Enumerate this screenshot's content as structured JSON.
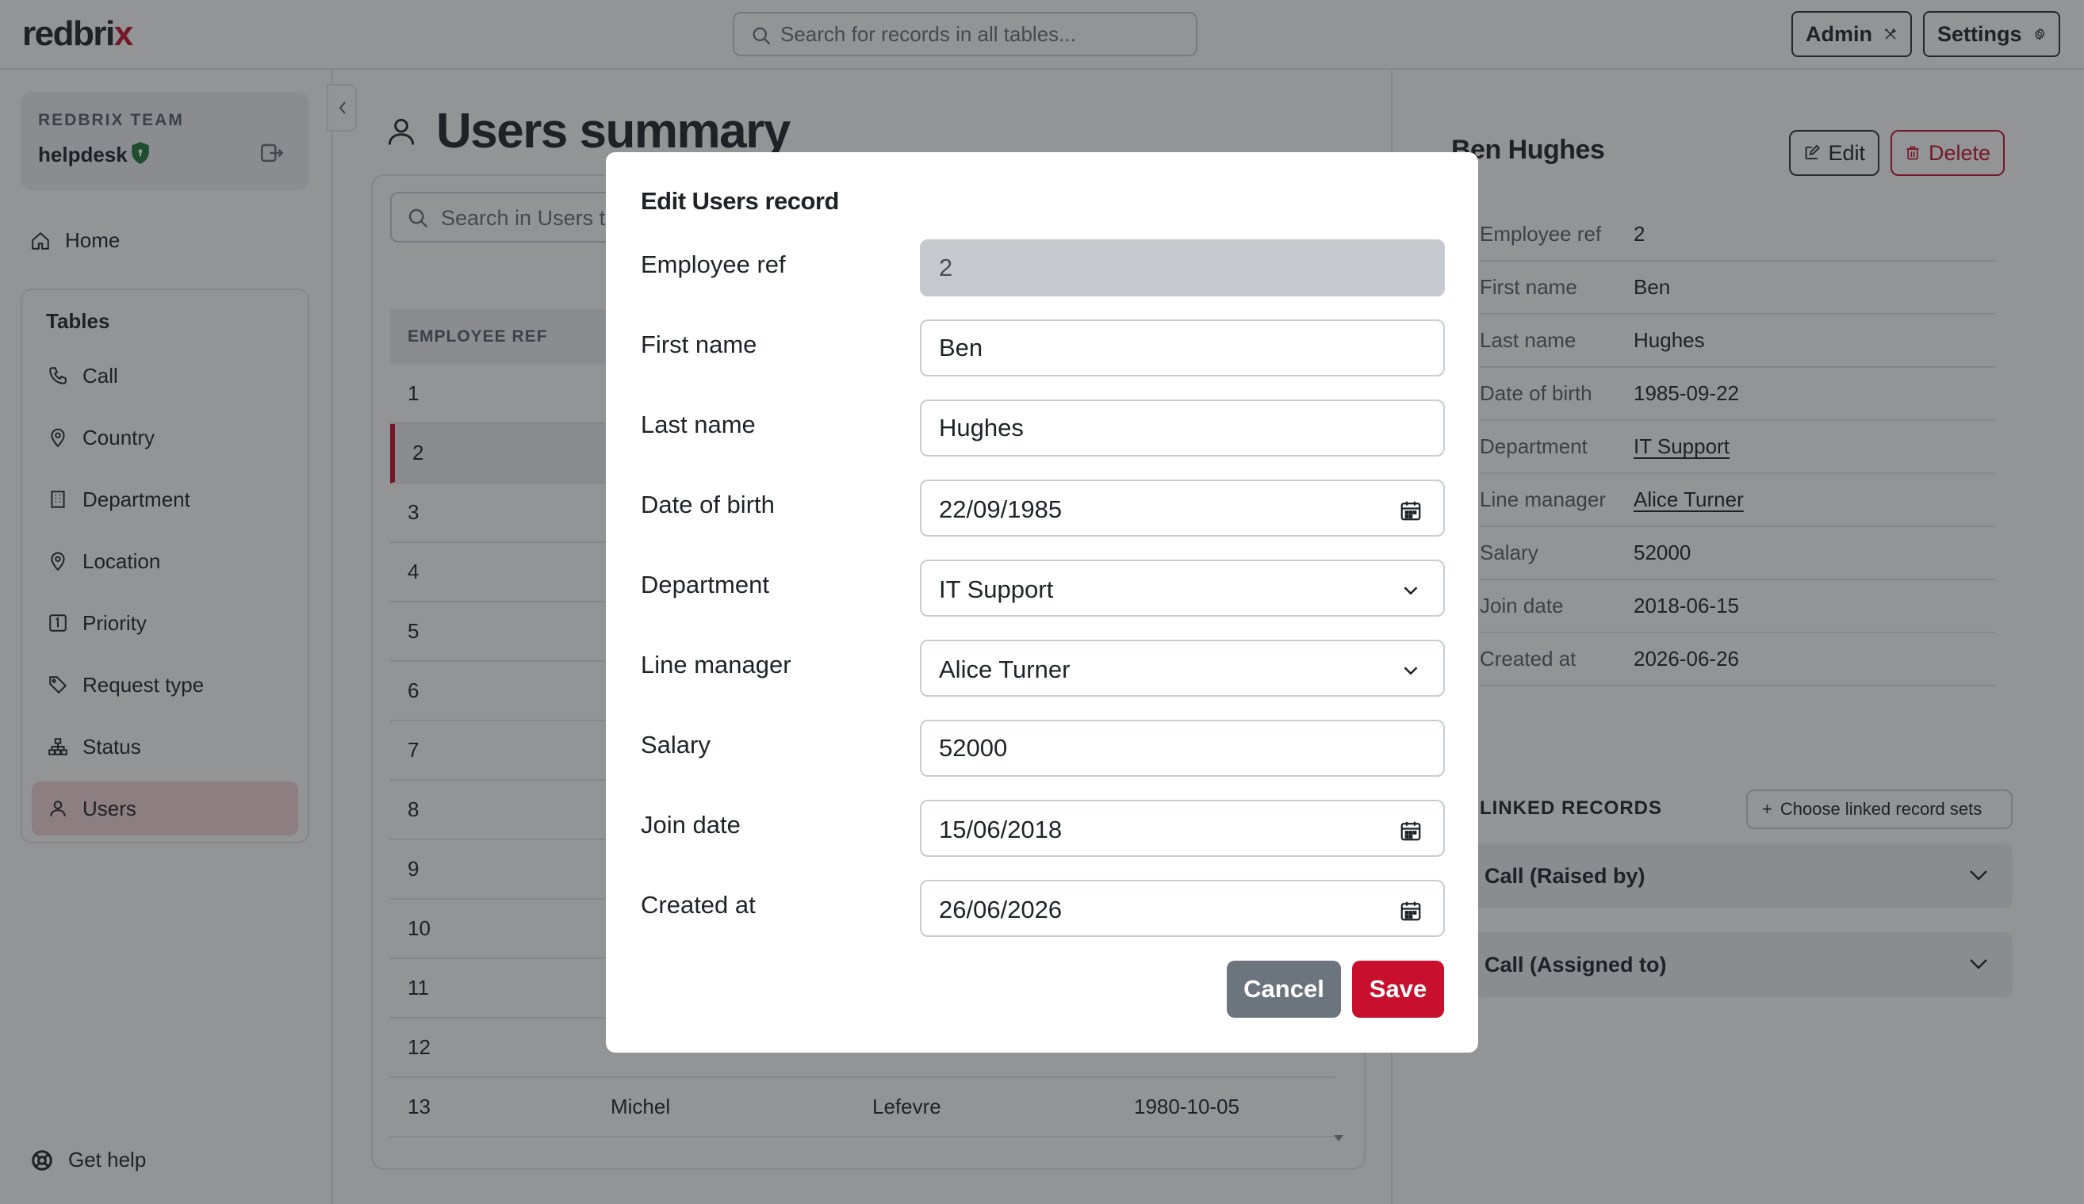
{
  "app": {
    "logo_main": "redbri",
    "logo_x": "x",
    "global_search_placeholder": "Search for records in all tables...",
    "admin_label": "Admin",
    "settings_label": "Settings"
  },
  "sidebar": {
    "team_label": "REDBRIX TEAM",
    "team_name": "helpdesk",
    "home_label": "Home",
    "tables_title": "Tables",
    "items": [
      {
        "label": "Call",
        "icon": "phone-icon"
      },
      {
        "label": "Country",
        "icon": "map-pin-icon"
      },
      {
        "label": "Department",
        "icon": "building-icon"
      },
      {
        "label": "Location",
        "icon": "map-pin-icon"
      },
      {
        "label": "Priority",
        "icon": "number-one-icon"
      },
      {
        "label": "Request type",
        "icon": "tag-icon"
      },
      {
        "label": "Status",
        "icon": "hierarchy-icon"
      },
      {
        "label": "Users",
        "icon": "user-icon"
      }
    ],
    "active_item": "Users",
    "help_label": "Get help"
  },
  "main": {
    "page_title": "Users summary",
    "search_placeholder": "Search in Users table...",
    "column_header_1": "EMPLOYEE REF",
    "rows": [
      {
        "ref": "1",
        "first": "",
        "last": "",
        "dob": ""
      },
      {
        "ref": "2",
        "first": "",
        "last": "",
        "dob": ""
      },
      {
        "ref": "3",
        "first": "",
        "last": "",
        "dob": ""
      },
      {
        "ref": "4",
        "first": "",
        "last": "",
        "dob": ""
      },
      {
        "ref": "5",
        "first": "",
        "last": "",
        "dob": ""
      },
      {
        "ref": "6",
        "first": "",
        "last": "",
        "dob": ""
      },
      {
        "ref": "7",
        "first": "",
        "last": "",
        "dob": ""
      },
      {
        "ref": "8",
        "first": "",
        "last": "",
        "dob": ""
      },
      {
        "ref": "9",
        "first": "",
        "last": "",
        "dob": ""
      },
      {
        "ref": "10",
        "first": "",
        "last": "",
        "dob": ""
      },
      {
        "ref": "11",
        "first": "",
        "last": "",
        "dob": ""
      },
      {
        "ref": "12",
        "first": "",
        "last": "",
        "dob": ""
      },
      {
        "ref": "13",
        "first": "Michel",
        "last": "Lefevre",
        "dob": "1980-10-05"
      }
    ],
    "selected_row": "2"
  },
  "detail": {
    "name": "Ben Hughes",
    "edit_label": "Edit",
    "delete_label": "Delete",
    "fields": [
      {
        "key": "Employee ref",
        "value": "2",
        "link": false
      },
      {
        "key": "First name",
        "value": "Ben",
        "link": false
      },
      {
        "key": "Last name",
        "value": "Hughes",
        "link": false
      },
      {
        "key": "Date of birth",
        "value": "1985-09-22",
        "link": false
      },
      {
        "key": "Department",
        "value": "IT Support",
        "link": true
      },
      {
        "key": "Line manager",
        "value": "Alice Turner",
        "link": true
      },
      {
        "key": "Salary",
        "value": "52000",
        "link": false
      },
      {
        "key": "Join date",
        "value": "2018-06-15",
        "link": false
      },
      {
        "key": "Created at",
        "value": "2026-06-26",
        "link": false
      }
    ],
    "linked_title": "LINKED RECORDS",
    "choose_label": "Choose linked record sets",
    "accordions": [
      "Call (Raised by)",
      "Call (Assigned to)"
    ]
  },
  "modal": {
    "title": "Edit Users record",
    "fields": {
      "employee_ref": {
        "label": "Employee ref",
        "value": "2"
      },
      "first_name": {
        "label": "First name",
        "value": "Ben"
      },
      "last_name": {
        "label": "Last name",
        "value": "Hughes"
      },
      "date_of_birth": {
        "label": "Date of birth",
        "value": "22/09/1985"
      },
      "department": {
        "label": "Department",
        "value": "IT Support"
      },
      "line_manager": {
        "label": "Line manager",
        "value": "Alice Turner"
      },
      "salary": {
        "label": "Salary",
        "value": "52000"
      },
      "join_date": {
        "label": "Join date",
        "value": "15/06/2018"
      },
      "created_at": {
        "label": "Created at",
        "value": "26/06/2026"
      }
    },
    "cancel_label": "Cancel",
    "save_label": "Save"
  },
  "colors": {
    "brand_red": "#c8102e",
    "active_nav_bg": "#f3d6d6",
    "cancel_gray": "#6c757d",
    "shield_green": "#1e7a3c"
  }
}
